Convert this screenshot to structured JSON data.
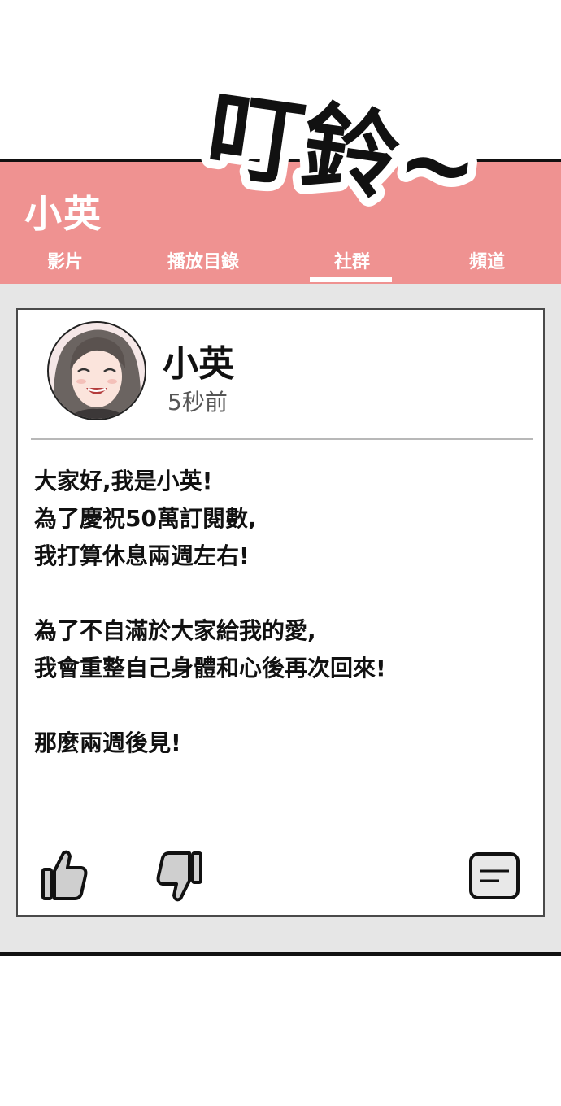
{
  "header": {
    "channel_name": "小英",
    "tabs": [
      {
        "label": "影片"
      },
      {
        "label": "播放目錄"
      },
      {
        "label": "社群",
        "active": true
      },
      {
        "label": "頻道"
      }
    ]
  },
  "post": {
    "author": "小英",
    "time": "5秒前",
    "paragraphs": [
      [
        "大家好,我是小英!",
        "為了慶祝50萬訂閱數,",
        "我打算休息兩週左右!"
      ],
      [
        "為了不自滿於大家給我的愛,",
        "我會重整自己身體和心後再次回來!"
      ],
      [
        "那麼兩週後見!"
      ]
    ],
    "actions": {
      "like_icon": "thumbs-up-icon",
      "dislike_icon": "thumbs-down-icon",
      "comment_icon": "comment-icon"
    }
  },
  "sfx": {
    "text": "叮鈴~"
  },
  "colors": {
    "header_bg": "#ef9291",
    "panel_bg": "#e6e6e6",
    "card_bg": "#ffffff"
  }
}
